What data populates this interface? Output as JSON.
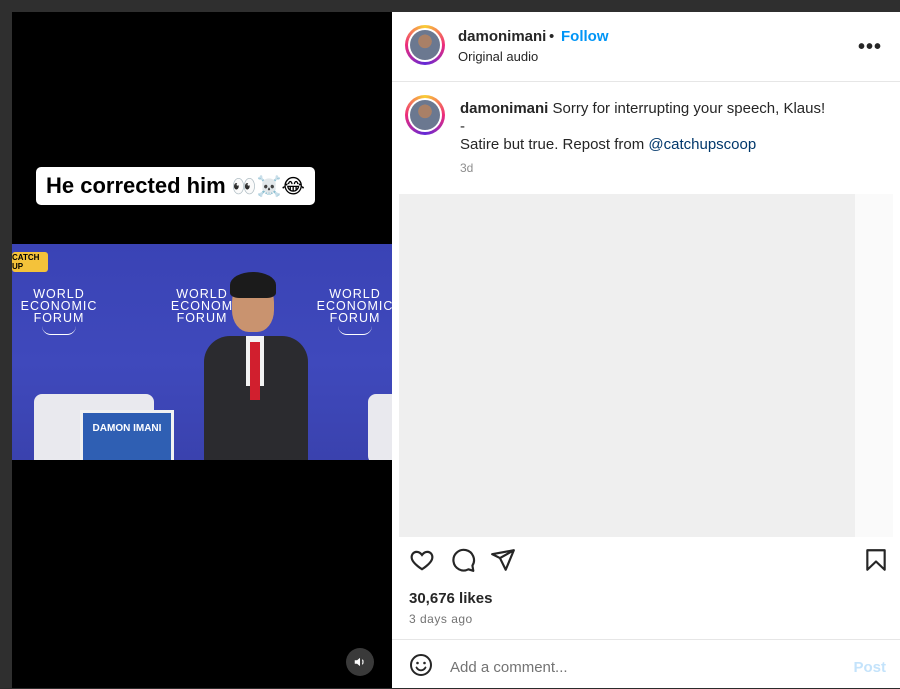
{
  "video": {
    "caption": "He corrected him",
    "caption_emoji": "👀☠️😂",
    "brand_sticker": "CATCH UP",
    "wef_logo_lines": [
      "WORLD",
      "ECONOMIC",
      "FORUM"
    ],
    "wef_logo_lines_mid": [
      "WORLD",
      "ECONOM",
      "FORUM"
    ],
    "nameplate": "DAMON IMANI",
    "sound_icon": "speaker-icon"
  },
  "post": {
    "username": "damonimani",
    "dot": "•",
    "follow_label": "Follow",
    "audio": "Original audio",
    "more_icon": "more-horizontal-icon",
    "more_glyph": "•••"
  },
  "comment": {
    "username": "damonimani",
    "text_line1": "Sorry for interrupting your speech, Klaus!",
    "text_line2": "-",
    "text_line3_prefix": "Satire but true. Repost from ",
    "mention": "@catchupscoop",
    "time": "3d"
  },
  "actions": {
    "like_icon": "heart-icon",
    "comment_icon": "comment-icon",
    "share_icon": "send-icon",
    "save_icon": "bookmark-icon"
  },
  "stats": {
    "likes": "30,676 likes",
    "posted_ago": "3 days ago"
  },
  "add_comment": {
    "emoji_icon": "emoji-icon",
    "placeholder": "Add a comment...",
    "post_label": "Post"
  },
  "colors": {
    "accent": "#0095f6",
    "mention": "#00376b",
    "post_disabled": "#c4e3fb"
  }
}
